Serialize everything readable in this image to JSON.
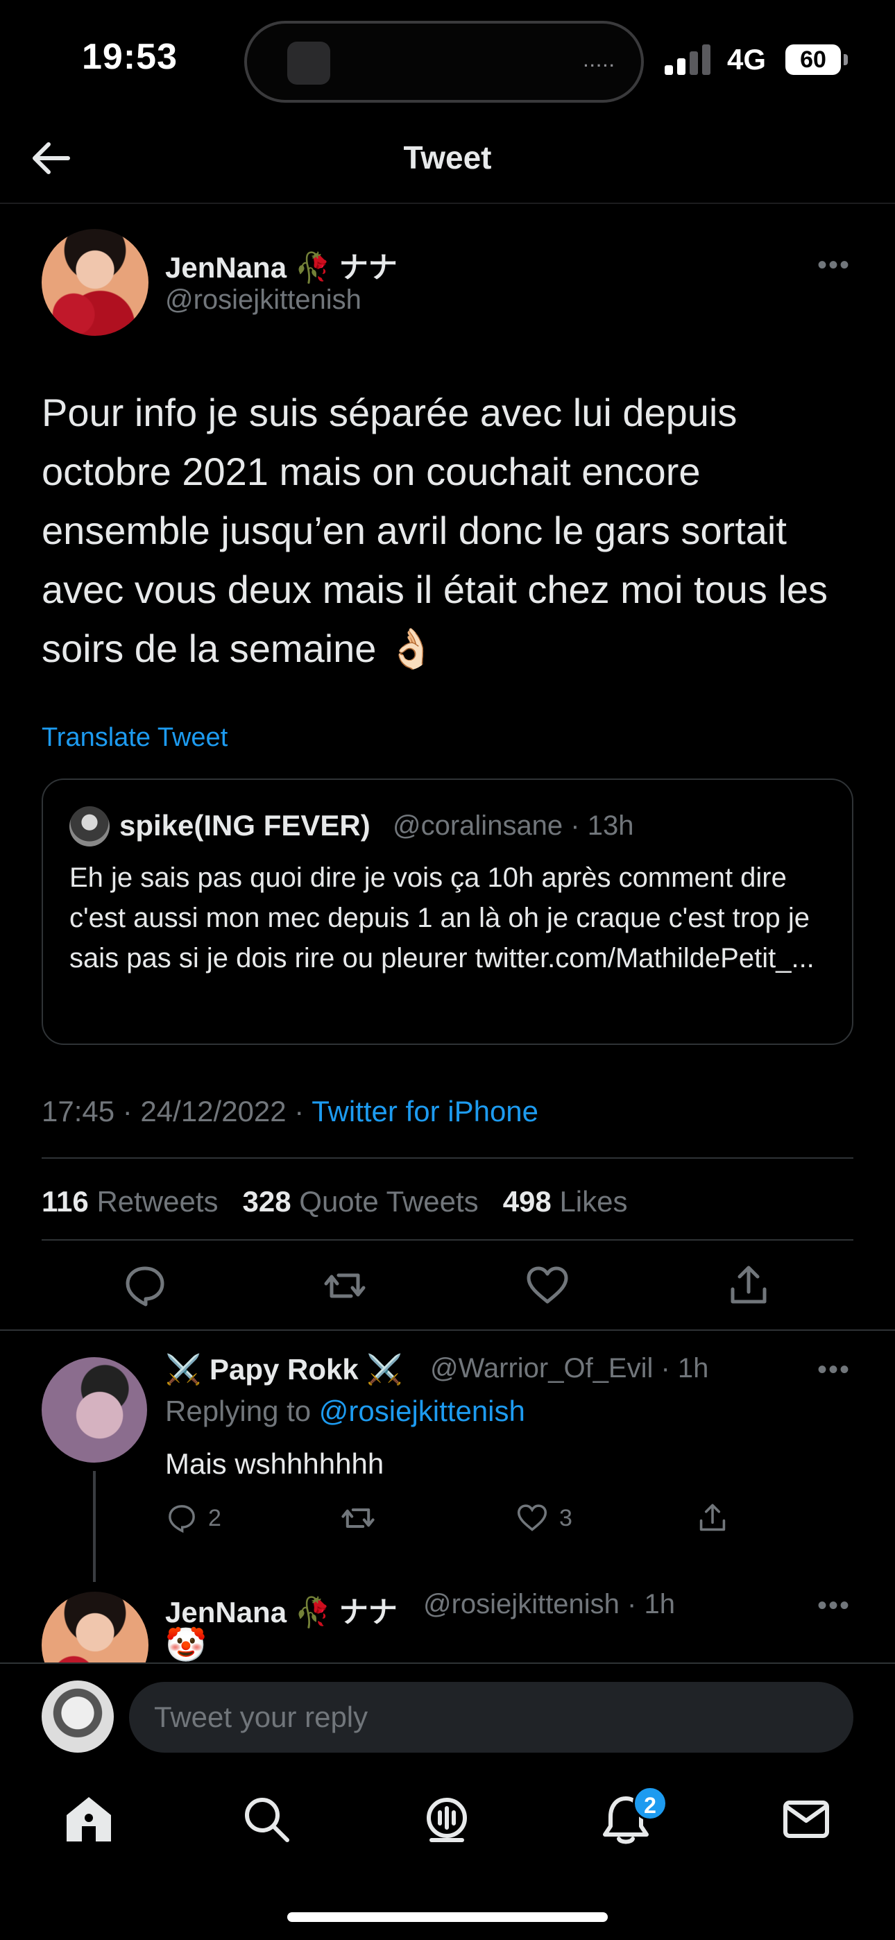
{
  "status_bar": {
    "time": "19:53",
    "network": "4G",
    "battery": "60"
  },
  "header": {
    "title": "Tweet"
  },
  "main_tweet": {
    "name": "JenNana 🥀 ナナ",
    "handle": "@rosiejkittenish",
    "text": "Pour info je suis séparée avec lui depuis octobre 2021 mais on couchait encore ensemble jusqu’en avril donc le gars sortait avec vous deux mais il était chez moi tous les soirs de la semaine 👌🏻",
    "translate_label": "Translate Tweet",
    "quote": {
      "name": "spike(ING FEVER)",
      "handle_time": "@coralinsane · 13h",
      "text": "Eh je sais pas quoi dire je vois ça 10h après comment dire c'est aussi mon mec depuis 1 an là oh je craque c'est trop je sais pas si je dois rire ou pleurer twitter.com/MathildePetit_..."
    },
    "timestamp": "17:45 · 24/12/2022 · ",
    "client": "Twitter for iPhone",
    "stats": {
      "retweets_count": "116",
      "retweets_label": "Retweets",
      "quotes_count": "328",
      "quotes_label": "Quote Tweets",
      "likes_count": "498",
      "likes_label": "Likes"
    }
  },
  "replies": [
    {
      "name": "⚔️ Papy Rokk ⚔️",
      "handle_time": "@Warrior_Of_Evil · 1h",
      "replying_prefix": "Replying to ",
      "replying_handle": "@rosiejkittenish",
      "text": "Mais wshhhhhhh",
      "reply_count": "2",
      "like_count": "3"
    },
    {
      "name": "JenNana 🥀 ナナ",
      "handle_time": "@rosiejkittenish · 1h",
      "text": "🤡"
    }
  ],
  "composer": {
    "placeholder": "Tweet your reply"
  },
  "tabbar": {
    "notifications_badge": "2"
  },
  "colors": {
    "accent": "#1d9bf0",
    "background": "#000000",
    "muted": "#71767b"
  }
}
